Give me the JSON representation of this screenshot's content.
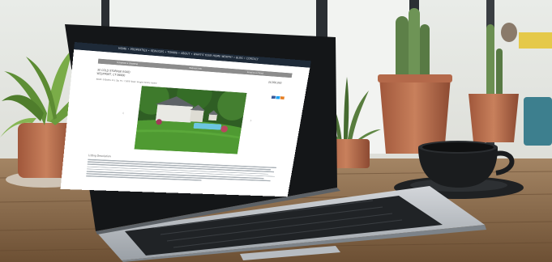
{
  "scene": "laptop on wooden desk with potted plants and a black coffee cup",
  "website": {
    "nav_links": "HOME  •  PROPERTIES  •  SERVICES  •  TOWNS  •  ABOUT  •  WHAT'S YOUR HOME WORTH?  •  BLOG  •  CONTACT",
    "tabs": [
      "Schedule a Showing",
      "Request Info",
      "Email to a Friend"
    ],
    "address_line1": "30 COLD STORAGE ROAD",
    "address_line2": "WESTPORT, CT 06880",
    "price": "$4,300,000",
    "stats": "Beds: 6    Baths: 6.1    Sq. Ft.: 7,800    Type: Single Family Home",
    "description_title": "Listing Description"
  },
  "colors": {
    "nav": "#1e2a38",
    "subbar": "#8c8c8c",
    "lawn": "#4f9a32",
    "pool": "#6cc6e0",
    "cup": "#1a1c1e",
    "desk": "#8a6a48"
  }
}
